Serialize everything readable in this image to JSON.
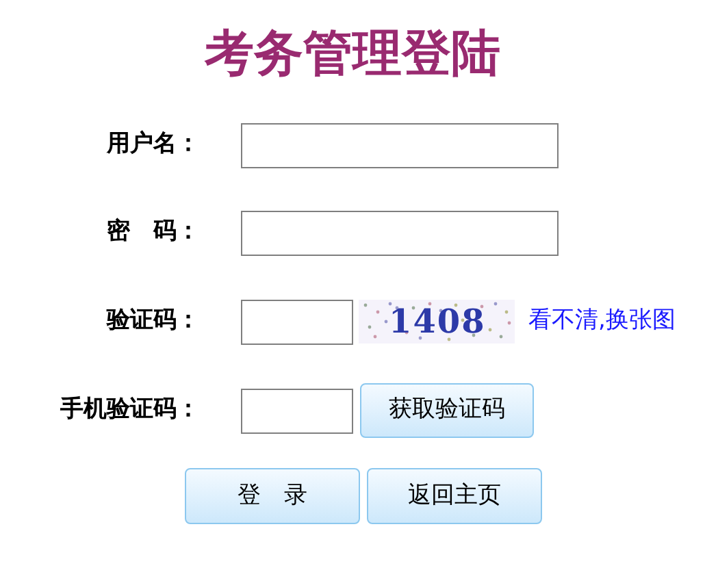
{
  "title": "考务管理登陆",
  "fields": [
    {
      "label": "用户名：",
      "kind": "text"
    },
    {
      "label": "密　码：",
      "kind": "password"
    },
    {
      "label": "验证码：",
      "kind": "captcha",
      "captcha": "1408",
      "link": "看不清,换张图"
    },
    {
      "label": "手机验证码：",
      "kind": "sms",
      "button": "获取验证码"
    }
  ],
  "buttons": [
    "登　录",
    "返回主页"
  ]
}
